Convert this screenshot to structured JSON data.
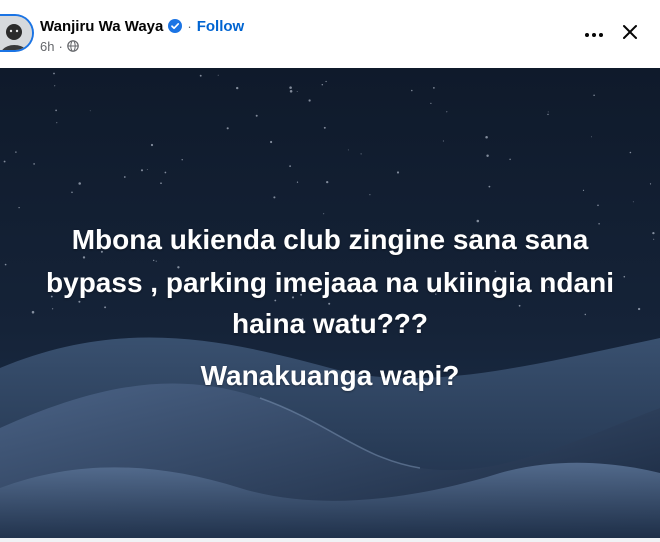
{
  "post": {
    "author": "Wanjiru Wa Waya",
    "follow_label": "Follow",
    "time": "6h",
    "separator": "·",
    "icons": {
      "verified": "verified-badge-icon",
      "audience": "globe-icon",
      "more": "more-options-icon",
      "close": "close-icon"
    }
  },
  "image": {
    "lines": [
      "Mbona ukienda club zingine sana sana",
      "bypass , parking imejaaa na ukiingia ndani",
      "haina watu???",
      "Wanakuanga wapi?"
    ]
  },
  "colors": {
    "accent": "#0064d1",
    "verified": "#1b74e4",
    "sky_top": "#0f1a2b",
    "sky_bottom": "#1e3350"
  }
}
